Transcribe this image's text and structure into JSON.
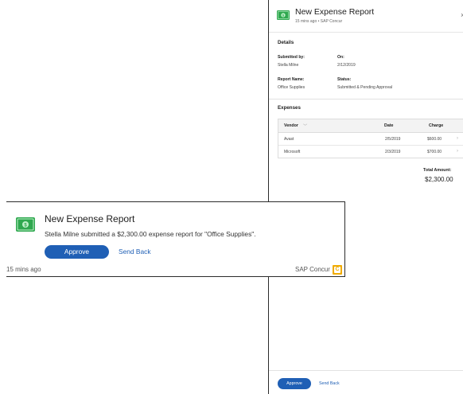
{
  "panel": {
    "title": "New Expense Report",
    "subtitle": "15 mins ago • SAP Concur",
    "details_heading": "Details",
    "submitted_by_label": "Submitted by:",
    "submitted_by_value": "Stella Milne",
    "on_label": "On:",
    "on_value": "2/12/2019",
    "report_name_label": "Report Name:",
    "report_name_value": "Office Supplies",
    "status_label": "Status:",
    "status_value": "Submitted & Pending Approval",
    "expenses_heading": "Expenses",
    "columns": {
      "vendor": "Vendor",
      "date": "Date",
      "charge": "Charge"
    },
    "rows": [
      {
        "vendor": "Avast",
        "date": "2/5/2019",
        "charge": "$600.00"
      },
      {
        "vendor": "Microsoft",
        "date": "2/3/2019",
        "charge": "$700.00"
      }
    ],
    "total_label": "Total Amount:",
    "total_value": "$2,300.00",
    "approve_label": "Approve",
    "send_back_label": "Send Back"
  },
  "toast": {
    "title": "New Expense Report",
    "body": "Stella Milne submitted a $2,300.00 expense report for \"Office Supplies\".",
    "approve_label": "Approve",
    "send_back_label": "Send Back",
    "time": "15 mins ago",
    "source": "SAP Concur"
  },
  "colors": {
    "accent": "#1f5fb5",
    "money_icon": "#2fa84f",
    "concur_logo": "#f0ab00"
  },
  "icons": {
    "app": "money-bill-icon",
    "close": "close-icon",
    "sort": "chevron-down-icon",
    "row": "chevron-right-icon",
    "brand": "concur-logo-icon"
  }
}
